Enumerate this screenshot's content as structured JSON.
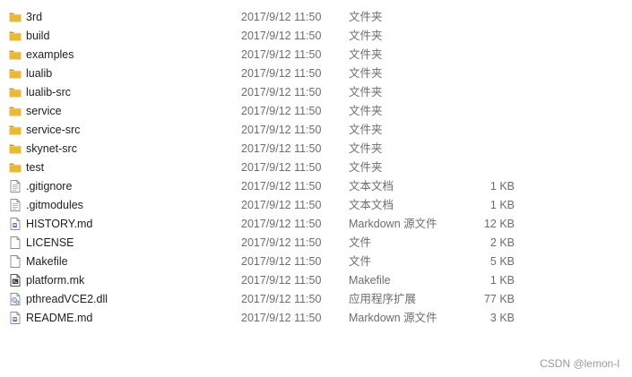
{
  "colors": {
    "folder": "#e8b93a",
    "folder_dark": "#c99722",
    "doc_border": "#8c8c8c",
    "md_badge": "#3a6fb5",
    "meta_text": "#6d6d6d"
  },
  "files": [
    {
      "name": "3rd",
      "date": "2017/9/12 11:50",
      "type": "文件夹",
      "size": "",
      "icon": "folder-icon"
    },
    {
      "name": "build",
      "date": "2017/9/12 11:50",
      "type": "文件夹",
      "size": "",
      "icon": "folder-icon"
    },
    {
      "name": "examples",
      "date": "2017/9/12 11:50",
      "type": "文件夹",
      "size": "",
      "icon": "folder-icon"
    },
    {
      "name": "lualib",
      "date": "2017/9/12 11:50",
      "type": "文件夹",
      "size": "",
      "icon": "folder-icon"
    },
    {
      "name": "lualib-src",
      "date": "2017/9/12 11:50",
      "type": "文件夹",
      "size": "",
      "icon": "folder-icon"
    },
    {
      "name": "service",
      "date": "2017/9/12 11:50",
      "type": "文件夹",
      "size": "",
      "icon": "folder-icon"
    },
    {
      "name": "service-src",
      "date": "2017/9/12 11:50",
      "type": "文件夹",
      "size": "",
      "icon": "folder-icon"
    },
    {
      "name": "skynet-src",
      "date": "2017/9/12 11:50",
      "type": "文件夹",
      "size": "",
      "icon": "folder-icon"
    },
    {
      "name": "test",
      "date": "2017/9/12 11:50",
      "type": "文件夹",
      "size": "",
      "icon": "folder-icon"
    },
    {
      "name": ".gitignore",
      "date": "2017/9/12 11:50",
      "type": "文本文档",
      "size": "1 KB",
      "icon": "text-document-icon"
    },
    {
      "name": ".gitmodules",
      "date": "2017/9/12 11:50",
      "type": "文本文档",
      "size": "1 KB",
      "icon": "text-document-icon"
    },
    {
      "name": "HISTORY.md",
      "date": "2017/9/12 11:50",
      "type": "Markdown 源文件",
      "size": "12 KB",
      "icon": "markdown-file-icon"
    },
    {
      "name": "LICENSE",
      "date": "2017/9/12 11:50",
      "type": "文件",
      "size": "2 KB",
      "icon": "blank-file-icon"
    },
    {
      "name": "Makefile",
      "date": "2017/9/12 11:50",
      "type": "文件",
      "size": "5 KB",
      "icon": "blank-file-icon"
    },
    {
      "name": "platform.mk",
      "date": "2017/9/12 11:50",
      "type": "Makefile",
      "size": "1 KB",
      "icon": "makefile-icon"
    },
    {
      "name": "pthreadVCE2.dll",
      "date": "2017/9/12 11:50",
      "type": "应用程序扩展",
      "size": "77 KB",
      "icon": "dll-file-icon"
    },
    {
      "name": "README.md",
      "date": "2017/9/12 11:50",
      "type": "Markdown 源文件",
      "size": "3 KB",
      "icon": "markdown-file-icon"
    }
  ],
  "watermark": "CSDN @lemon-l"
}
